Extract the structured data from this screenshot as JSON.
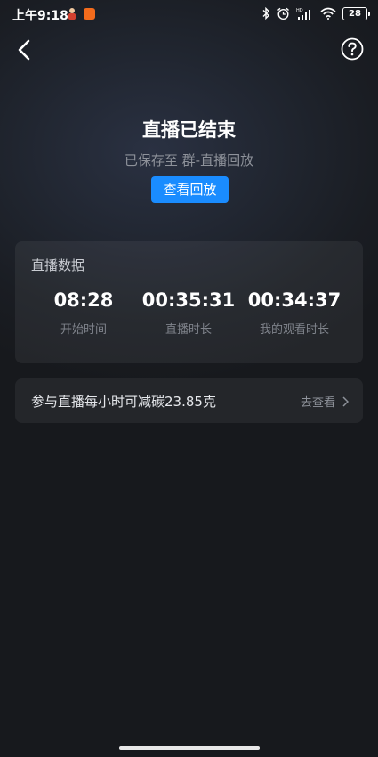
{
  "status_bar": {
    "time": "上午9:18",
    "battery": "28"
  },
  "header": {
    "back_icon": "chevron-left-icon",
    "help_icon": "question-circle-icon"
  },
  "summary": {
    "title": "直播已结束",
    "subtitle": "已保存至 群-直播回放",
    "replay_button": "查看回放"
  },
  "stats": {
    "title": "直播数据",
    "items": [
      {
        "value": "08:28",
        "label": "开始时间"
      },
      {
        "value": "00:35:31",
        "label": "直播时长"
      },
      {
        "value": "00:34:37",
        "label": "我的观看时长"
      }
    ]
  },
  "carbon": {
    "text": "参与直播每小时可减碳23.85克",
    "link": "去查看"
  },
  "colors": {
    "accent": "#1a8cff",
    "card": "rgba(255,255,255,0.06)"
  }
}
